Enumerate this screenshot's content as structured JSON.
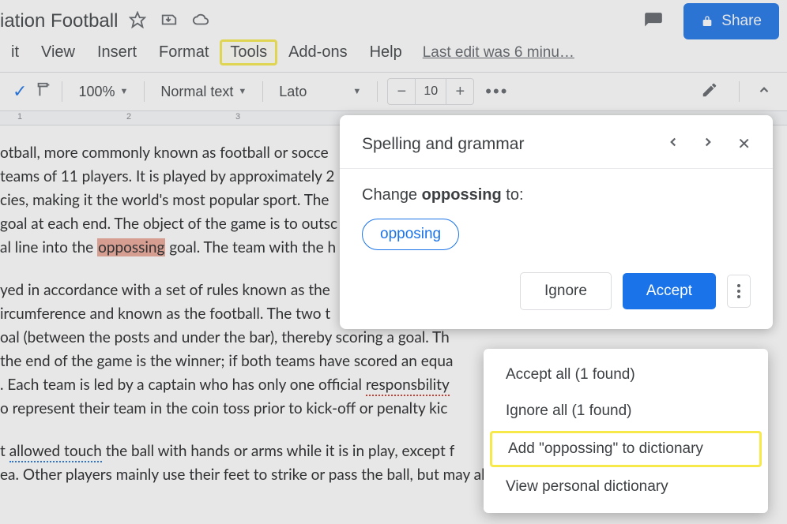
{
  "header": {
    "title": "iation Football",
    "share_label": "Share"
  },
  "menubar": {
    "items": [
      "it",
      "View",
      "Insert",
      "Format",
      "Tools",
      "Add-ons",
      "Help"
    ],
    "last_edit": "Last edit was 6 minu…"
  },
  "toolbar": {
    "zoom": "100%",
    "style": "Normal text",
    "font": "Lato",
    "font_size": "10"
  },
  "ruler": {
    "marks": [
      "1",
      "2",
      "3"
    ]
  },
  "document": {
    "p1_a": "otball, more commonly known as football or socce",
    "p1_b": "teams of 11 players. It is played by approximately 2",
    "p1_c": "cies, making it the world's most popular sport. The",
    "p1_d": "goal at each end. The object of the game is to outsc",
    "p1_e_pre": "al line into the ",
    "p1_e_word": "oppossing",
    "p1_e_post": " goal. The team with the h",
    "p2_a": "yed in accordance with a set of rules known as the",
    "p2_b": "ircumference and known as the football. The two t",
    "p2_c": "oal (between the posts and under the bar), thereby scoring a goal. Th",
    "p2_d": "the end of the game is the winner; if both teams have scored an equa",
    "p2_e_pre": ". Each team is led by a captain who has only one official ",
    "p2_e_word": "responsbility",
    "p2_f": "o represent their team in the coin toss prior to kick-off or penalty kic",
    "p3_a_pre": "t ",
    "p3_a_word": "allowed touch",
    "p3_a_post": " the ball with hands or arms while it is in play, except f",
    "p3_b": "ea. Other players mainly use their feet to strike or pass the ball, but may also use any other"
  },
  "spelling": {
    "title": "Spelling and grammar",
    "change_label": "Change",
    "misspelled": "oppossing",
    "to_label": "to:",
    "suggestion": "opposing",
    "ignore": "Ignore",
    "accept": "Accept"
  },
  "context_menu": {
    "items": [
      "Accept all (1 found)",
      "Ignore all (1 found)",
      "Add \"oppossing\" to dictionary",
      "View personal dictionary"
    ]
  }
}
